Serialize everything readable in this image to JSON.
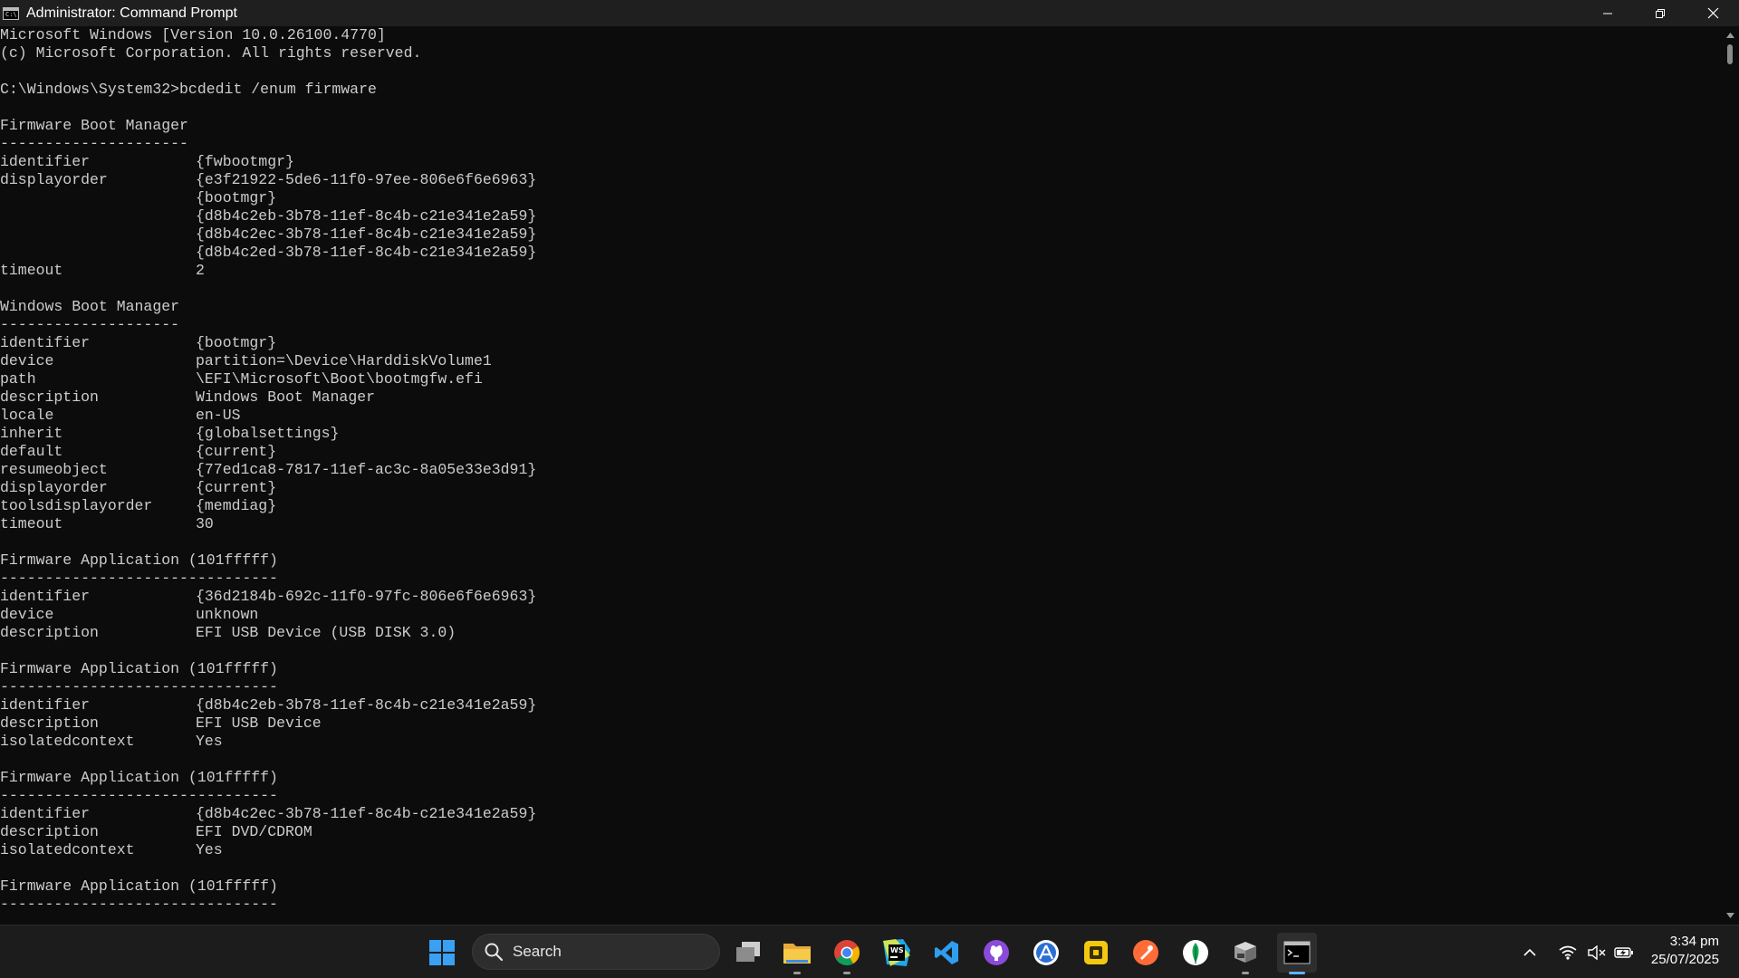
{
  "window": {
    "title": "Administrator: Command Prompt",
    "icon_label": "C:\\"
  },
  "console": {
    "lines": [
      {
        "t": "Microsoft Windows [Version 10.0.26100.4770]"
      },
      {
        "t": "(c) Microsoft Corporation. All rights reserved."
      },
      {
        "t": ""
      },
      {
        "t": "C:\\Windows\\System32>bcdedit /enum firmware"
      },
      {
        "t": ""
      },
      {
        "t": "Firmware Boot Manager"
      },
      {
        "t": "---------------------"
      },
      {
        "k": "identifier",
        "v": "{fwbootmgr}"
      },
      {
        "k": "displayorder",
        "v": "{e3f21922-5de6-11f0-97ee-806e6f6e6963}"
      },
      {
        "k": "",
        "v": "{bootmgr}"
      },
      {
        "k": "",
        "v": "{d8b4c2eb-3b78-11ef-8c4b-c21e341e2a59}"
      },
      {
        "k": "",
        "v": "{d8b4c2ec-3b78-11ef-8c4b-c21e341e2a59}"
      },
      {
        "k": "",
        "v": "{d8b4c2ed-3b78-11ef-8c4b-c21e341e2a59}"
      },
      {
        "k": "timeout",
        "v": "2"
      },
      {
        "t": ""
      },
      {
        "t": "Windows Boot Manager"
      },
      {
        "t": "--------------------"
      },
      {
        "k": "identifier",
        "v": "{bootmgr}"
      },
      {
        "k": "device",
        "v": "partition=\\Device\\HarddiskVolume1"
      },
      {
        "k": "path",
        "v": "\\EFI\\Microsoft\\Boot\\bootmgfw.efi"
      },
      {
        "k": "description",
        "v": "Windows Boot Manager"
      },
      {
        "k": "locale",
        "v": "en-US"
      },
      {
        "k": "inherit",
        "v": "{globalsettings}"
      },
      {
        "k": "default",
        "v": "{current}"
      },
      {
        "k": "resumeobject",
        "v": "{77ed1ca8-7817-11ef-ac3c-8a05e33e3d91}"
      },
      {
        "k": "displayorder",
        "v": "{current}"
      },
      {
        "k": "toolsdisplayorder",
        "v": "{memdiag}"
      },
      {
        "k": "timeout",
        "v": "30"
      },
      {
        "t": ""
      },
      {
        "t": "Firmware Application (101fffff)"
      },
      {
        "t": "-------------------------------"
      },
      {
        "k": "identifier",
        "v": "{36d2184b-692c-11f0-97fc-806e6f6e6963}"
      },
      {
        "k": "device",
        "v": "unknown"
      },
      {
        "k": "description",
        "v": "EFI USB Device (USB DISK 3.0)"
      },
      {
        "t": ""
      },
      {
        "t": "Firmware Application (101fffff)"
      },
      {
        "t": "-------------------------------"
      },
      {
        "k": "identifier",
        "v": "{d8b4c2eb-3b78-11ef-8c4b-c21e341e2a59}"
      },
      {
        "k": "description",
        "v": "EFI USB Device"
      },
      {
        "k": "isolatedcontext",
        "v": "Yes"
      },
      {
        "t": ""
      },
      {
        "t": "Firmware Application (101fffff)"
      },
      {
        "t": "-------------------------------"
      },
      {
        "k": "identifier",
        "v": "{d8b4c2ec-3b78-11ef-8c4b-c21e341e2a59}"
      },
      {
        "k": "description",
        "v": "EFI DVD/CDROM"
      },
      {
        "k": "isolatedcontext",
        "v": "Yes"
      },
      {
        "t": ""
      },
      {
        "t": "Firmware Application (101fffff)"
      },
      {
        "t": "-------------------------------"
      }
    ]
  },
  "taskbar": {
    "search_label": "Search",
    "apps": [
      {
        "name": "start-button",
        "icon": "windows-logo-icon"
      },
      {
        "name": "task-view-button",
        "icon": "task-view-icon"
      },
      {
        "name": "file-explorer-button",
        "icon": "folder-icon",
        "running": true
      },
      {
        "name": "chrome-button",
        "icon": "chrome-icon",
        "running": true
      },
      {
        "name": "webstorm-button",
        "icon": "webstorm-icon"
      },
      {
        "name": "vscode-button",
        "icon": "vscode-icon"
      },
      {
        "name": "github-desktop-button",
        "icon": "github-icon"
      },
      {
        "name": "app-store-button",
        "icon": "app-a-icon"
      },
      {
        "name": "yellow-app-button",
        "icon": "yellow-app-icon"
      },
      {
        "name": "postman-button",
        "icon": "postman-icon"
      },
      {
        "name": "mongodb-compass-button",
        "icon": "mongodb-leaf-icon"
      },
      {
        "name": "vm-app-button",
        "icon": "vm-icon",
        "running": true
      },
      {
        "name": "terminal-button",
        "icon": "terminal-icon",
        "active": true
      }
    ],
    "clock": {
      "time": "3:34 pm",
      "date": "25/07/2025"
    }
  },
  "colors": {
    "console_bg": "#0c0c0c",
    "console_fg": "#cccccc",
    "titlebar_bg": "#1f1f1f",
    "taskbar_bg": "#1c1c1c",
    "active_indicator": "#5fb2ff"
  }
}
